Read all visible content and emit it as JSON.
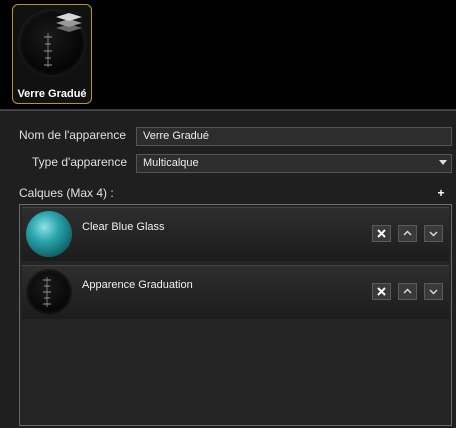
{
  "appearance_thumb": {
    "label": "Verre Gradué"
  },
  "form": {
    "name_label": "Nom de l'apparence",
    "name_value": "Verre Gradué",
    "type_label": "Type d'apparence",
    "type_value": "Multicalque",
    "layers_label": "Calques (Max 4) :",
    "add_symbol": "+"
  },
  "layers": [
    {
      "name": "Clear Blue Glass",
      "icon": "blue-glass-sphere"
    },
    {
      "name": "Apparence Graduation",
      "icon": "graduation-sphere"
    }
  ],
  "colors": {
    "accent_border": "#b8962e",
    "glass_blue": "#2aa6ad"
  }
}
